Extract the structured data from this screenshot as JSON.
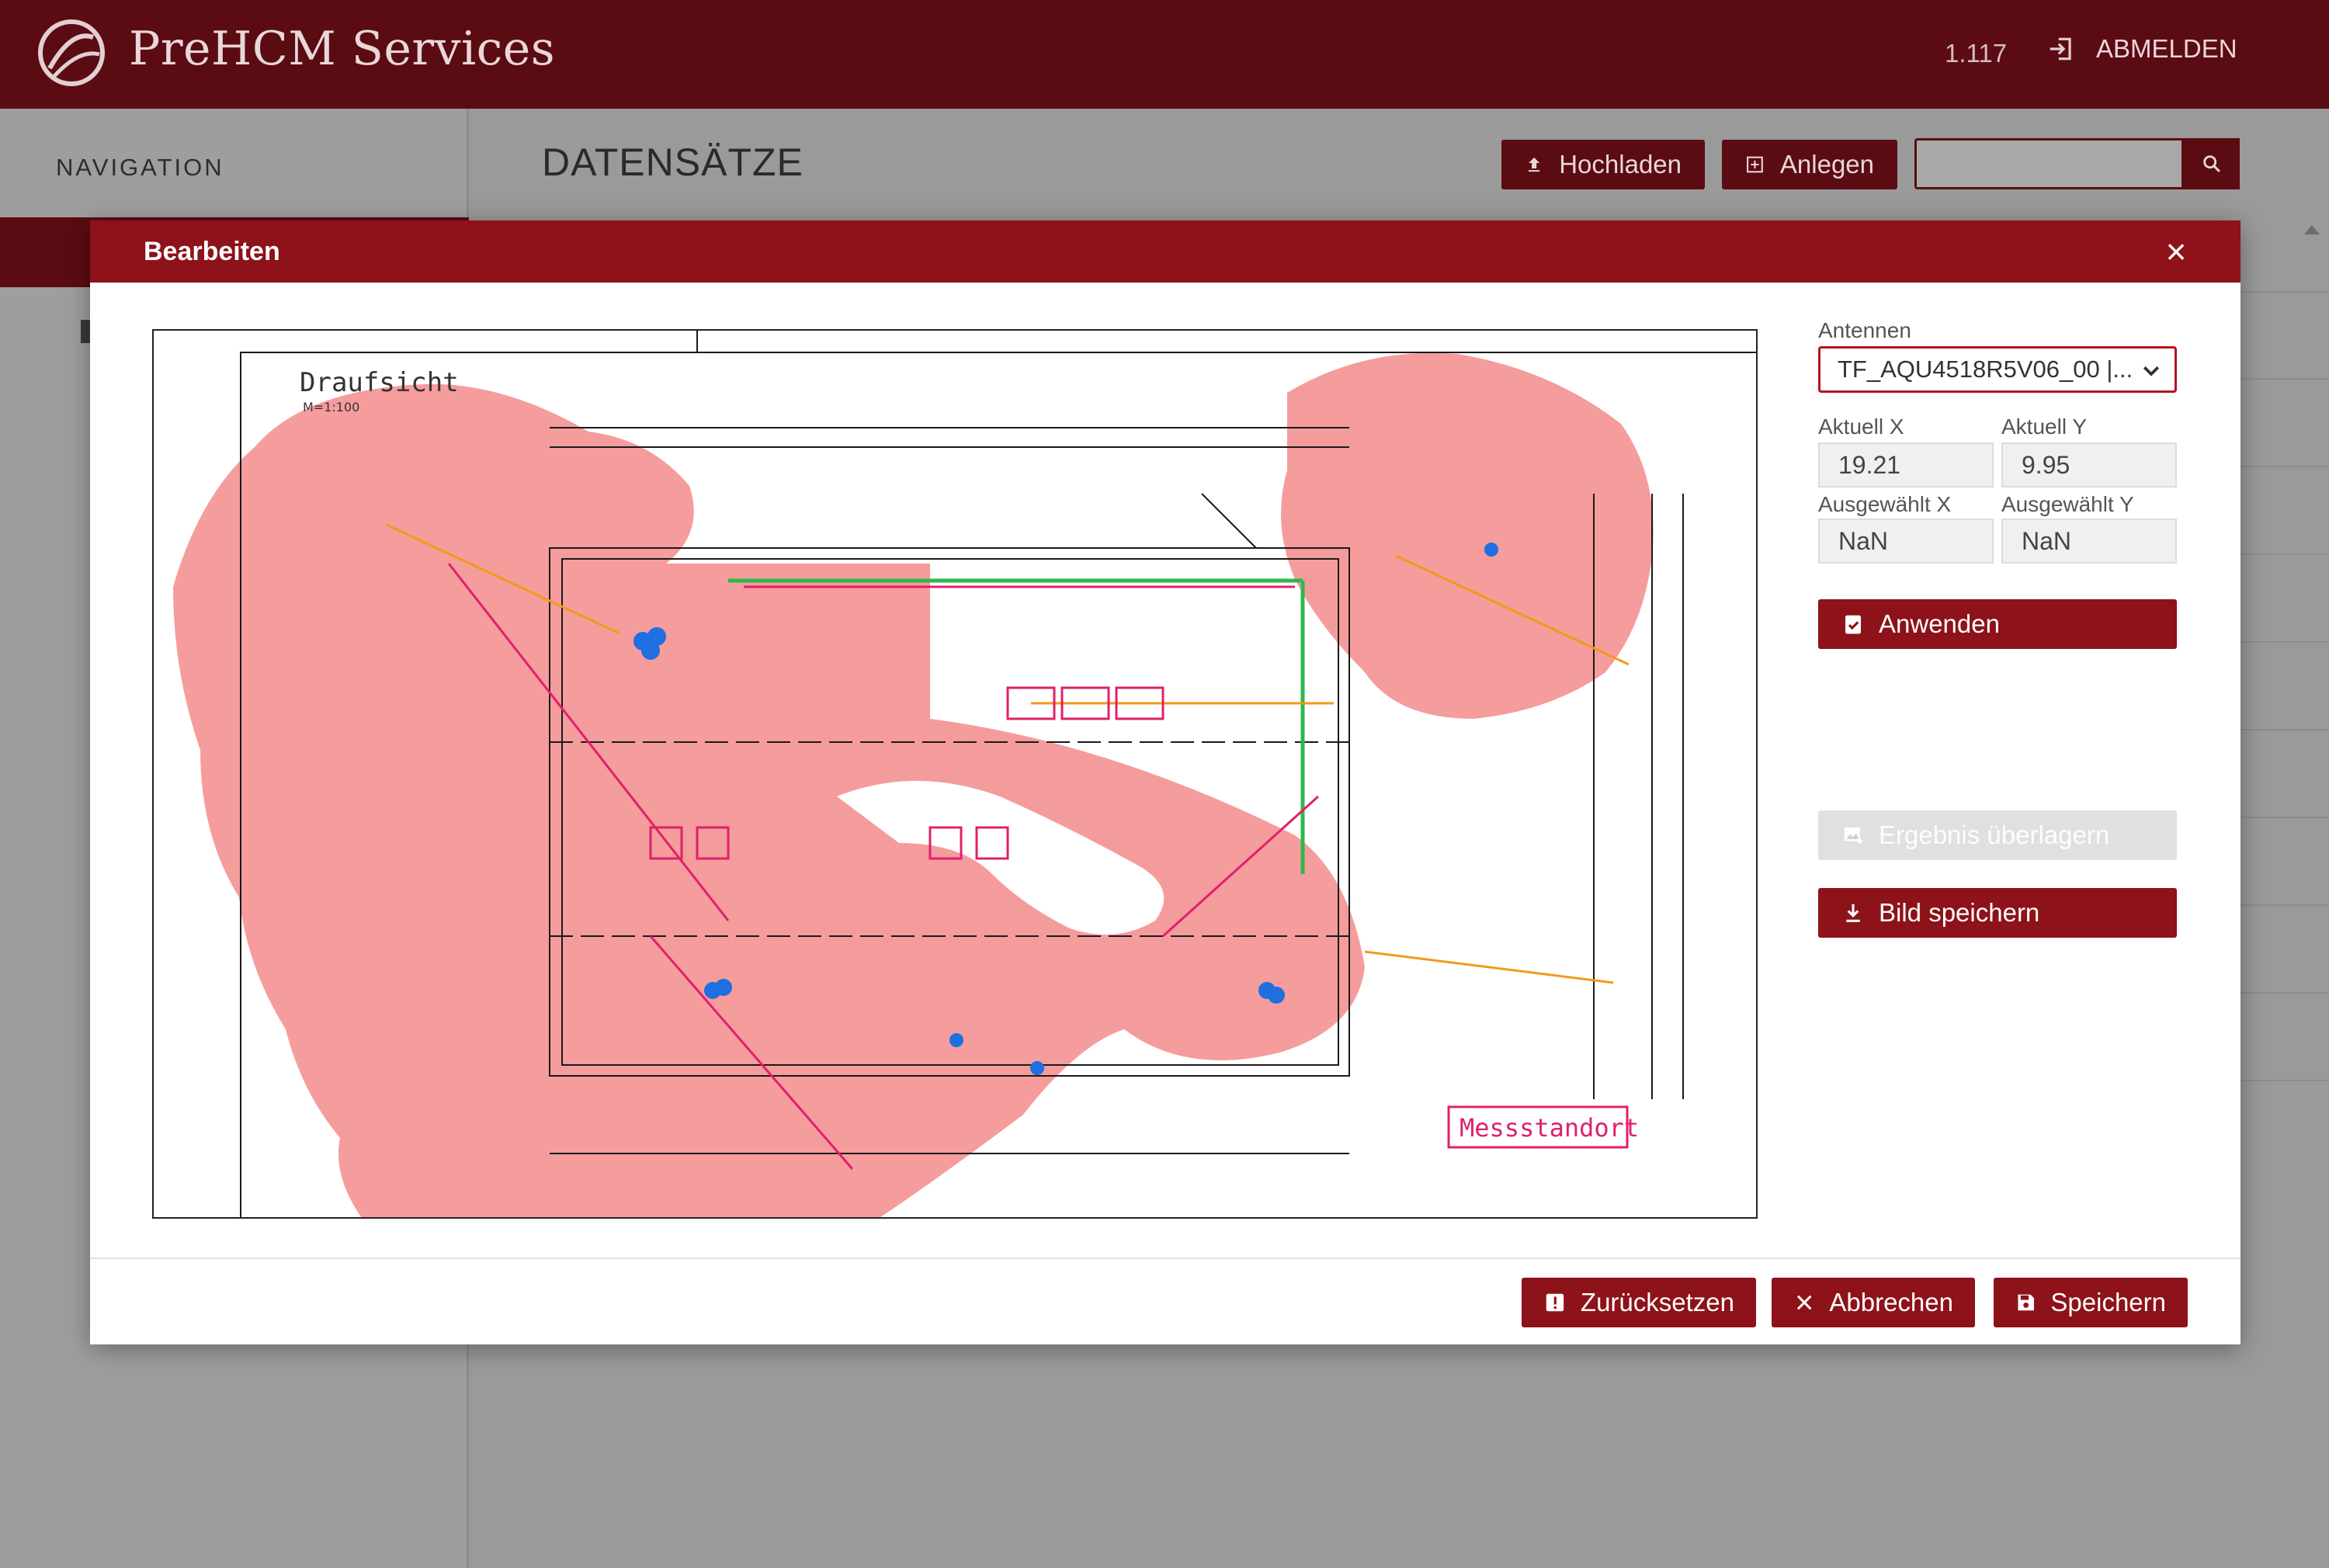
{
  "app": {
    "title": "PreHCM Services",
    "version": "1.117",
    "logout_label": "ABMELDEN",
    "brand_color": "#5b0b12",
    "accent_color": "#8d1219"
  },
  "sidebar": {
    "title": "NAVIGATION"
  },
  "page": {
    "title": "DATENSÄTZE",
    "upload_label": "Hochladen",
    "create_label": "Anlegen",
    "search_value": ""
  },
  "dialog": {
    "title": "Bearbeiten",
    "plan": {
      "heading": "Draufsicht",
      "scale": "M=1:100",
      "stamp": "Messstandort",
      "heatmap_color": "#f28b8b",
      "antenna_marker_color": "#1e6fe0"
    },
    "antenna_label": "Antennen",
    "antenna_selected": "TF_AQU4518R5V06_00 |...",
    "current_x_label": "Aktuell X",
    "current_y_label": "Aktuell Y",
    "current_x_value": "19.21",
    "current_y_value": "9.95",
    "selected_x_label": "Ausgewählt X",
    "selected_y_label": "Ausgewählt Y",
    "selected_x_value": "NaN",
    "selected_y_value": "NaN",
    "apply_label": "Anwenden",
    "overlay_label": "Ergebnis überlagern",
    "save_image_label": "Bild speichern",
    "reset_label": "Zurücksetzen",
    "cancel_label": "Abbrechen",
    "save_label": "Speichern"
  }
}
